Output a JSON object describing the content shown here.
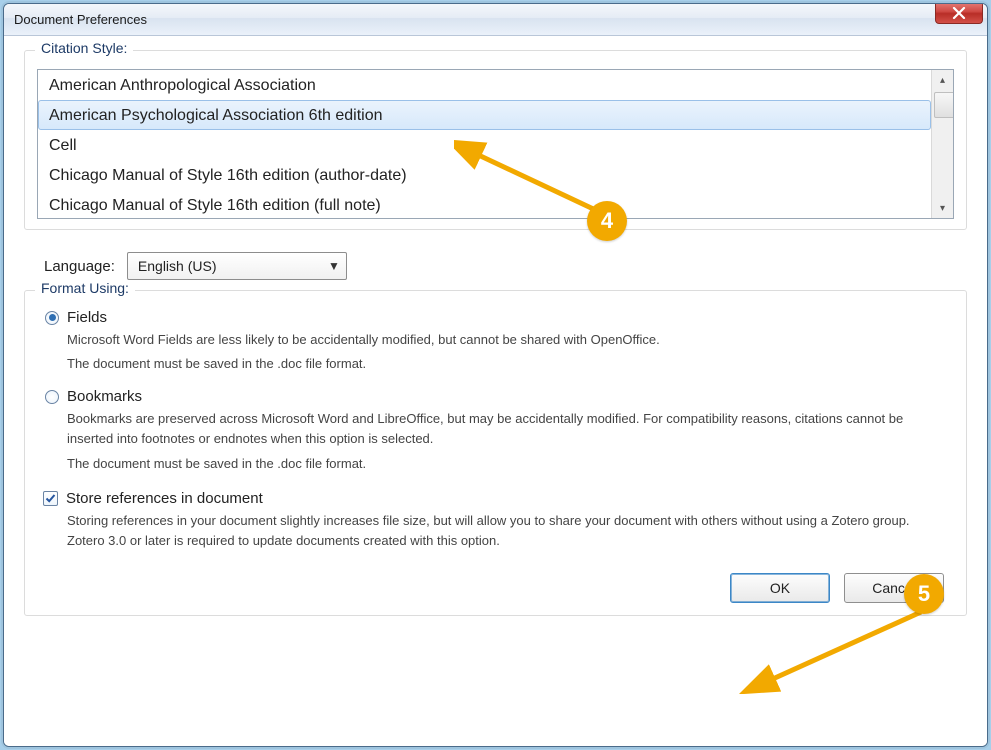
{
  "window": {
    "title": "Document Preferences"
  },
  "citation": {
    "legend": "Citation Style:",
    "items": [
      "American Anthropological Association",
      "American Psychological Association 6th edition",
      "Cell",
      "Chicago Manual of Style 16th edition (author-date)",
      "Chicago Manual of Style 16th edition (full note)"
    ],
    "selected_index": 1
  },
  "language": {
    "label": "Language:",
    "selected": "English (US)"
  },
  "format": {
    "legend": "Format Using:",
    "options": [
      {
        "id": "fields",
        "label": "Fields",
        "checked": true,
        "desc_lines": [
          "Microsoft Word Fields are less likely to be accidentally modified, but cannot be shared with OpenOffice.",
          "The document must be saved in the .doc file format."
        ]
      },
      {
        "id": "bookmarks",
        "label": "Bookmarks",
        "checked": false,
        "desc_lines": [
          "Bookmarks are preserved across Microsoft Word and LibreOffice, but may be accidentally modified. For compatibility reasons, citations cannot be inserted into footnotes or endnotes when this option is selected.",
          "The document must be saved in the .doc file format."
        ]
      }
    ]
  },
  "store_refs": {
    "label": "Store references in document",
    "checked": true,
    "desc": "Storing references in your document slightly increases file size, but will allow you to share your document with others without using a Zotero group. Zotero 3.0 or later is required to update documents created with this option."
  },
  "buttons": {
    "ok": "OK",
    "cancel": "Cancel"
  },
  "annotations": {
    "step4": "4",
    "step5": "5"
  },
  "colors": {
    "accent": "#f2a900",
    "selection": "#d7e9fb"
  }
}
